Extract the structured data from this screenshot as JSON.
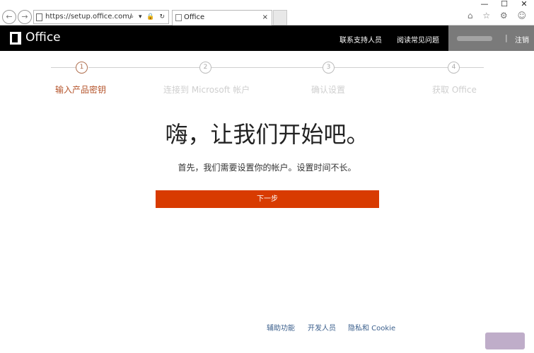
{
  "browser": {
    "window_controls": [
      "—",
      "☐",
      "✕"
    ],
    "back_glyph": "←",
    "forward_glyph": "→",
    "address_url": "https://setup.office.com/?sou",
    "address_icons": "⌕ ▾ 🔒 ↻",
    "tab_title": "Office",
    "tab_close": "×",
    "toolbar_glyphs": "⌂ ☆ ⚙ ☺"
  },
  "header": {
    "brand": "Office",
    "links": [
      "联系支持人员",
      "阅读常见问题"
    ],
    "separator": "|",
    "sign_out": "注销"
  },
  "steps": [
    {
      "number": "1",
      "label": "输入产品密钥",
      "active": true
    },
    {
      "number": "2",
      "label": "连接到 Microsoft 帐户",
      "active": false
    },
    {
      "number": "3",
      "label": "确认设置",
      "active": false
    },
    {
      "number": "4",
      "label": "获取 Office",
      "active": false
    }
  ],
  "main": {
    "title": "嗨，让我们开始吧。",
    "subtitle": "首先，我们需要设置你的帐户。设置时间不长。",
    "next_button": "下一步"
  },
  "footer": {
    "links": [
      "辅助功能",
      "开发人员",
      "隐私和 Cookie"
    ]
  },
  "colors": {
    "accent": "#d83b01",
    "active_step": "#b5542b",
    "header_bg": "#000000",
    "footer_link": "#3b5f8c"
  }
}
